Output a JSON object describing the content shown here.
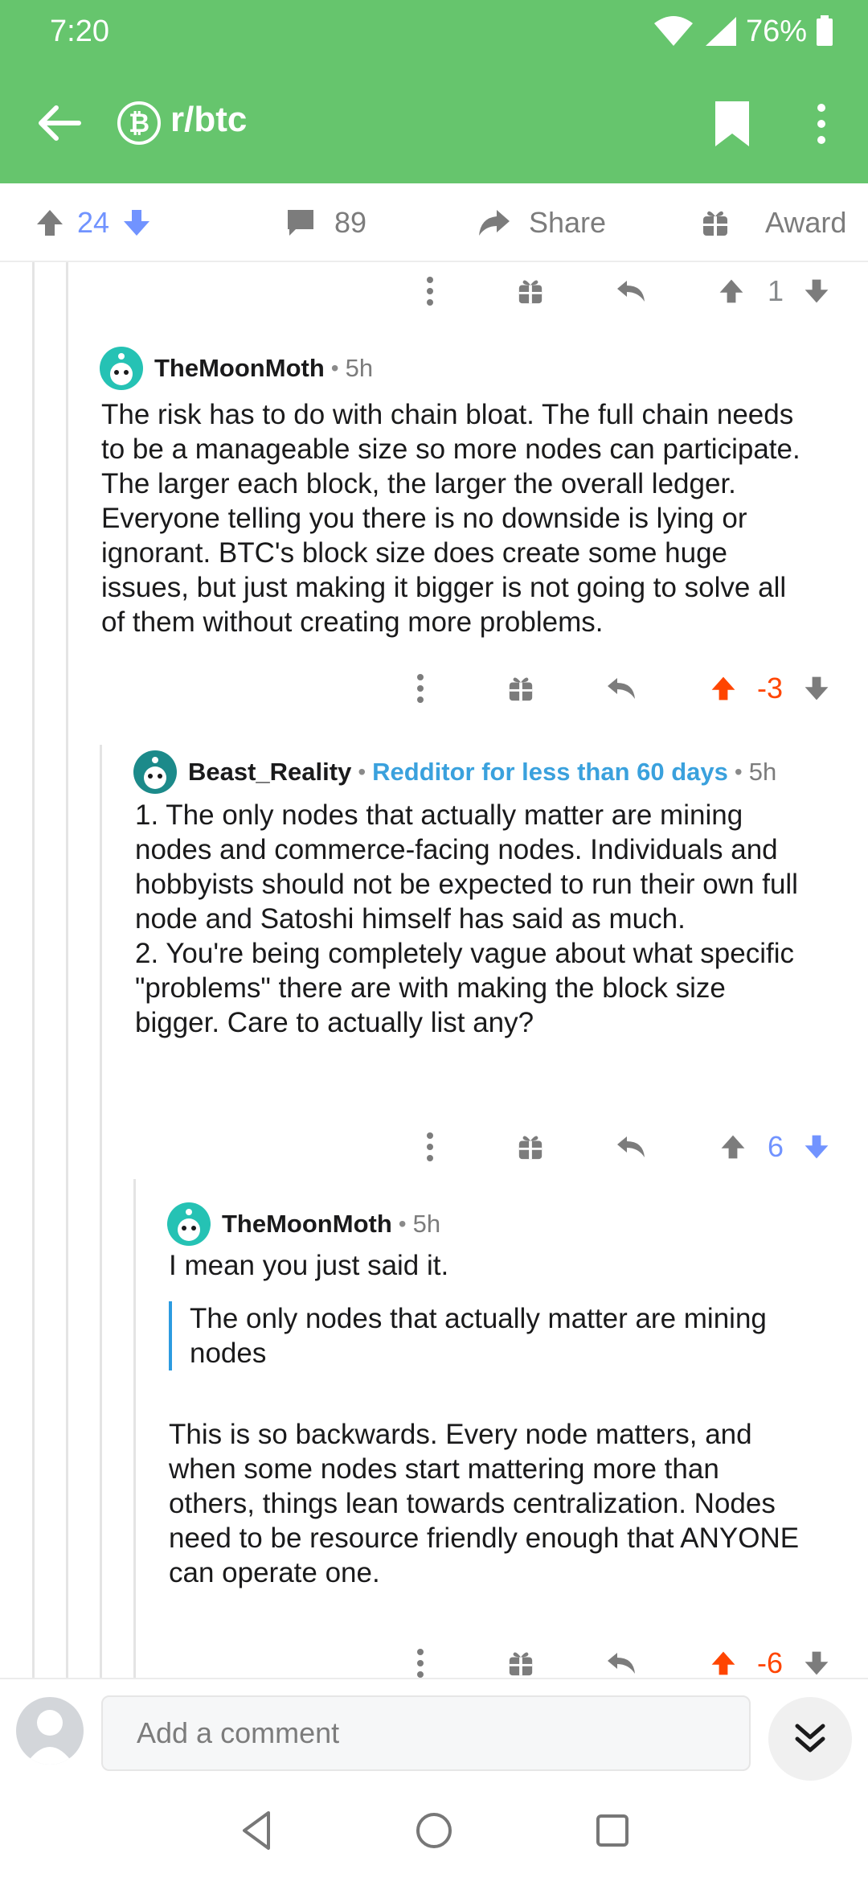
{
  "status": {
    "time": "7:20",
    "battery": "76%"
  },
  "appbar": {
    "subreddit": "r/btc",
    "sub_icon_glyph": "₿"
  },
  "post_actions": {
    "score": "24",
    "comments": "89",
    "share": "Share",
    "award": "Award"
  },
  "comments": [
    {
      "score": "1",
      "vote_state": "none"
    },
    {
      "author": "TheMoonMoth",
      "time": "5h",
      "body": "The risk has to do with chain bloat. The full chain needs\nto be a manageable size so more nodes can participate.\nThe larger each block, the larger the overall ledger.\nEveryone telling you there is no downside is lying or\nignorant. BTC's block size does create some huge\nissues, but just making it bigger is not going to solve all\nof them without creating more problems.",
      "score": "-3",
      "vote_state": "upvote-active"
    },
    {
      "author": "Beast_Reality",
      "flair": "Redditor for less than 60 days",
      "time": "5h",
      "body": "1. The only nodes that actually matter are mining\nnodes and commerce-facing nodes. Individuals and\nhobbyists should not be expected to run their own full\nnode and Satoshi himself has said as much.\n2. You're being completely vague about what specific\n\"problems\" there are with making the block size\nbigger. Care to actually list any?",
      "score": "6",
      "vote_state": "downvote-active"
    },
    {
      "author": "TheMoonMoth",
      "time": "5h",
      "body_intro": "I mean you just said it.",
      "quote": "The only nodes that actually matter are mining\nnodes",
      "body": "This is so backwards. Every node matters, and\nwhen some nodes start mattering more than\nothers, things lean towards centralization. Nodes\nneed to be resource friendly enough that ANYONE\ncan operate one.",
      "score": "-6",
      "vote_state": "upvote-active"
    }
  ],
  "composer": {
    "placeholder": "Add a comment"
  },
  "colors": {
    "appbar": "#66c56d",
    "upvote": "#ff4500",
    "downvote": "#7193ff",
    "flair": "#3aa1dd"
  },
  "icons": [
    "back-arrow-icon",
    "bitcoin-icon",
    "bookmark-icon",
    "more-vert-icon",
    "upvote-icon",
    "downvote-icon",
    "comment-icon",
    "share-icon",
    "gift-icon",
    "reply-icon",
    "collapse-icon",
    "nav-back-icon",
    "nav-home-icon",
    "nav-recents-icon"
  ]
}
